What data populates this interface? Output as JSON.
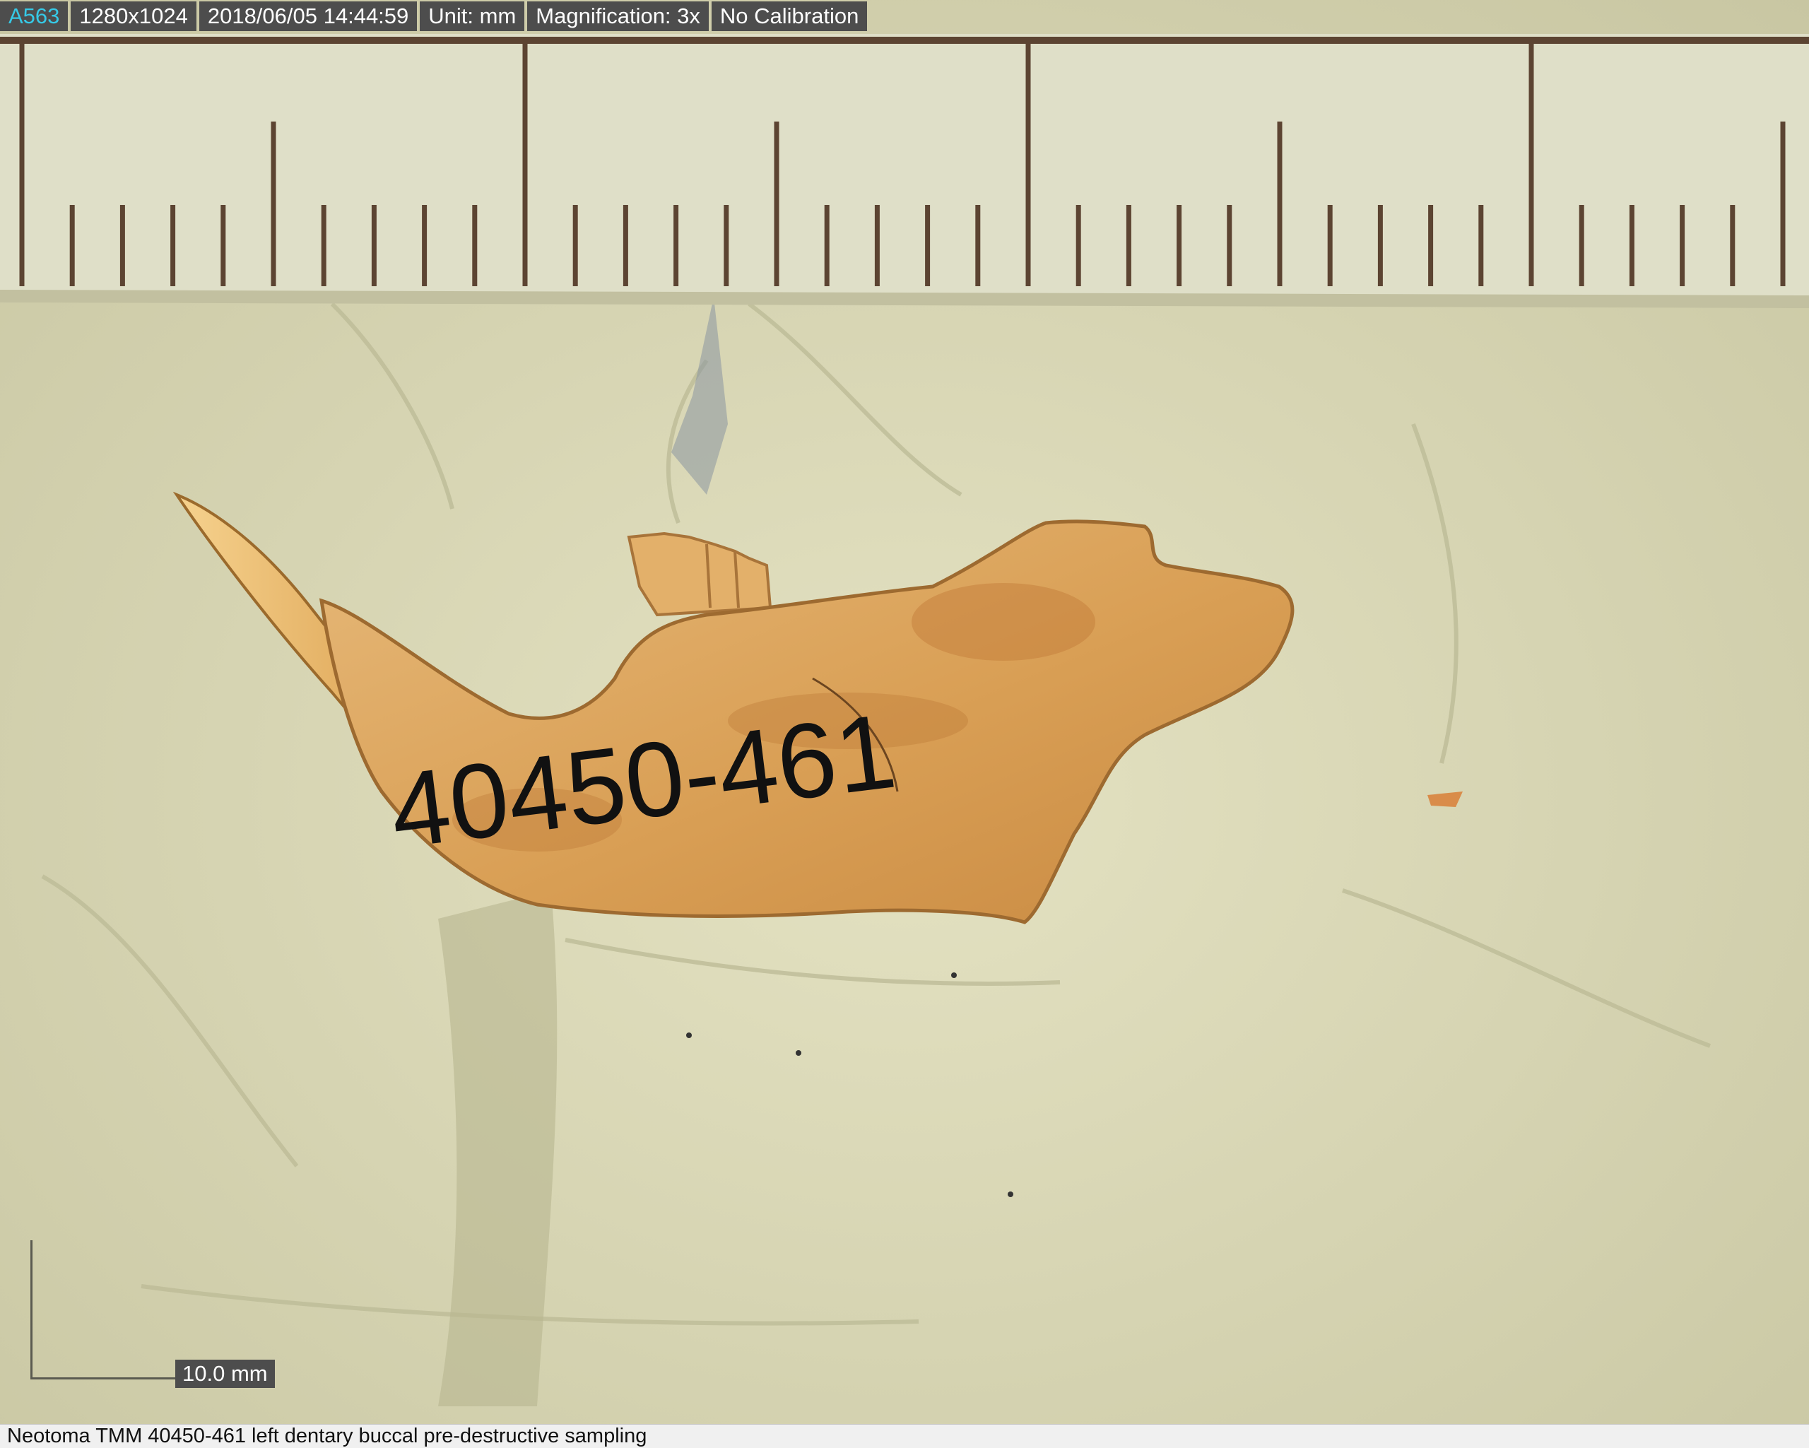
{
  "status_bar": {
    "id": "A563",
    "resolution": "1280x1024",
    "datetime": "2018/06/05 14:44:59",
    "unit": "Unit: mm",
    "magnification": "Magnification:  3x",
    "calibration": "No Calibration"
  },
  "specimen_label": "40450-461",
  "scale_bar": {
    "label": "10.0 mm"
  },
  "caption": "Neotoma TMM 40450-461 left dentary buccal pre-destructive sampling",
  "colors": {
    "putty": "#d6d4b2",
    "ruler": "#dfdfc8",
    "tick": "#5c4432",
    "bone": "#d9a35e",
    "incisor": "#e8b86a",
    "ink": "#111111",
    "id_text": "#36c9e6"
  }
}
